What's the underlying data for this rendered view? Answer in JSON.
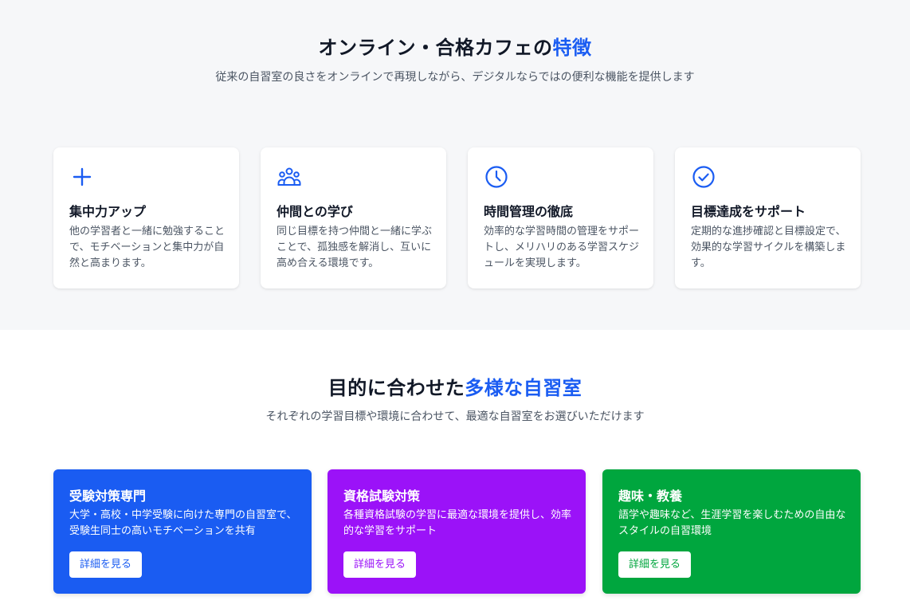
{
  "features": {
    "title_main": "オンライン・合格カフェの",
    "title_accent": "特徴",
    "subtitle": "従来の自習室の良さをオンラインで再現しながら、デジタルならではの便利な機能を提供します",
    "accent_color": "#1a5cf2",
    "items": [
      {
        "icon": "plus-icon",
        "title": "集中力アップ",
        "desc": "他の学習者と一緒に勉強することで、モチベーションと集中力が自然と高まります。"
      },
      {
        "icon": "users-icon",
        "title": "仲間との学び",
        "desc": "同じ目標を持つ仲間と一緒に学ぶことで、孤独感を解消し、互いに高め合える環境です。"
      },
      {
        "icon": "clock-icon",
        "title": "時間管理の徹底",
        "desc": "効率的な学習時間の管理をサポートし、メリハリのある学習スケジュールを実現します。"
      },
      {
        "icon": "check-circle-icon",
        "title": "目標達成をサポート",
        "desc": "定期的な進捗確認と目標設定で、効果的な学習サイクルを構築します。"
      }
    ]
  },
  "rooms": {
    "title_main": "目的に合わせた",
    "title_accent": "多様な自習室",
    "subtitle": "それぞれの学習目標や環境に合わせて、最適な自習室をお選びいただけます",
    "items": [
      {
        "title": "受験対策専門",
        "desc": "大学・高校・中学受験に向けた専門の自習室で、受験生同士の高いモチベーションを共有",
        "button": "詳細を見る",
        "color": "#1a5cf2"
      },
      {
        "title": "資格試験対策",
        "desc": "各種資格試験の学習に最適な環境を提供し、効率的な学習をサポート",
        "button": "詳細を見る",
        "color": "#9b12f8"
      },
      {
        "title": "趣味・教養",
        "desc": "語学や趣味など、生涯学習を楽しむための自由なスタイルの自習環境",
        "button": "詳細を見る",
        "color": "#00a63e"
      }
    ]
  }
}
